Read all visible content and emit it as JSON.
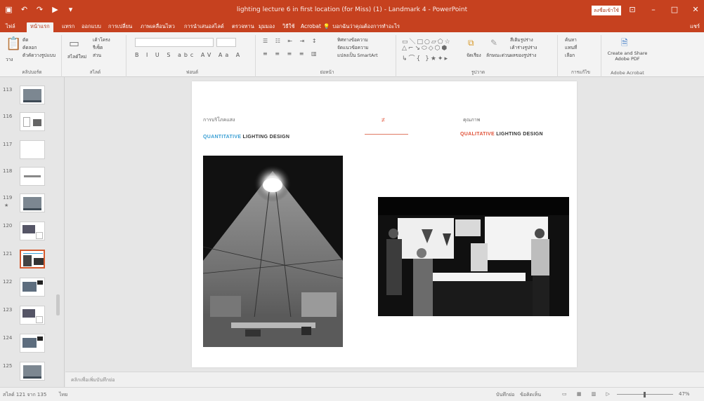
{
  "window": {
    "title": "lighting lecture 6 in first location (for Miss) (1) - Landmark 4 - PowerPoint",
    "sign_in": "ลงชื่อเข้าใช้",
    "share": "แชร์",
    "qat_icons": [
      "save-icon",
      "undo-icon",
      "redo-icon",
      "present-icon",
      "more-icon"
    ]
  },
  "tabs": [
    {
      "label": "ไฟล์",
      "active": false
    },
    {
      "label": "หน้าแรก",
      "active": true
    },
    {
      "label": "แทรก",
      "active": false
    },
    {
      "label": "ออกแบบ",
      "active": false
    },
    {
      "label": "การเปลี่ยน",
      "active": false
    },
    {
      "label": "ภาพเคลื่อนไหว",
      "active": false
    },
    {
      "label": "การนำเสนอสไลด์",
      "active": false
    },
    {
      "label": "ตรวจทาน",
      "active": false
    },
    {
      "label": "มุมมอง",
      "active": false
    },
    {
      "label": "วิธีใช้",
      "active": false
    },
    {
      "label": "Acrobat",
      "active": false
    }
  ],
  "tell_me": "บอกฉันว่าคุณต้องการทำอะไร",
  "ribbon": {
    "clipboard": {
      "label": "คลิปบอร์ด",
      "paste": "วาง",
      "cut": "ตัด",
      "copy": "คัดลอก",
      "format_painter": "ตัวคัดวางรูปแบบ"
    },
    "slides": {
      "label": "สไลด์",
      "new_slide": "สไลด์ใหม่",
      "layout": "เค้าโครง",
      "reset": "รีเซ็ต",
      "section": "ส่วน"
    },
    "font": {
      "label": "ฟอนต์"
    },
    "paragraph": {
      "label": "ย่อหน้า",
      "text_direction": "ทิศทางข้อความ",
      "align_text": "จัดแนวข้อความ",
      "convert_smartart": "แปลงเป็น SmartArt"
    },
    "drawing": {
      "label": "รูปวาด",
      "arrange": "จัดเรียง",
      "quick_styles": "ลักษณะด่วน",
      "shape_fill": "สีเติมรูปร่าง",
      "shape_outline": "เค้าร่างรูปร่าง",
      "shape_effects": "ผลของรูปร่าง"
    },
    "editing": {
      "label": "การแก้ไข",
      "find": "ค้นหา",
      "replace": "แทนที่",
      "select": "เลือก"
    },
    "acrobat": {
      "label": "Adobe Acrobat",
      "create_pdf": "Create and Share Adobe PDF"
    }
  },
  "thumbnails": [
    {
      "num": "113",
      "star": false,
      "active": false,
      "kind": "photo"
    },
    {
      "num": "116",
      "star": false,
      "active": false,
      "kind": "sketch"
    },
    {
      "num": "117",
      "star": false,
      "active": false,
      "kind": "blank"
    },
    {
      "num": "118",
      "star": false,
      "active": false,
      "kind": "title"
    },
    {
      "num": "119",
      "star": true,
      "active": false,
      "kind": "photo"
    },
    {
      "num": "120",
      "star": false,
      "active": false,
      "kind": "doc"
    },
    {
      "num": "121",
      "star": false,
      "active": true,
      "kind": "current"
    },
    {
      "num": "122",
      "star": false,
      "active": false,
      "kind": "photo2"
    },
    {
      "num": "123",
      "star": false,
      "active": false,
      "kind": "doc"
    },
    {
      "num": "124",
      "star": false,
      "active": false,
      "kind": "photo2"
    },
    {
      "num": "125",
      "star": false,
      "active": false,
      "kind": "photo"
    }
  ],
  "slide": {
    "left_thai": "การบริโภคแสง",
    "left_heading_a": "QUANTITATIVE",
    "left_heading_b": "LIGHTING DESIGN",
    "center_mark": "≠",
    "right_thai": "คุณภาพ",
    "right_heading_a": "QUALITATIVE",
    "right_heading_b": "LIGHTING DESIGN"
  },
  "notes_placeholder": "คลิกเพื่อเพิ่มบันทึกย่อ",
  "status": {
    "slide_info": "สไลด์ 121 จาก 135",
    "language": "ไทย",
    "notes_btn": "บันทึกย่อ",
    "comments_btn": "ข้อคิดเห็น",
    "zoom": "47%"
  },
  "colors": {
    "accent": "#c6411f",
    "blue_heading": "#3a9fd4",
    "red_heading": "#e0533a"
  }
}
